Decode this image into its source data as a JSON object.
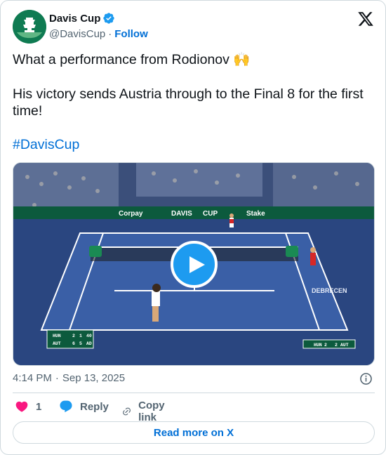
{
  "author": {
    "name": "Davis Cup",
    "handle": "@DavisCup",
    "separator": "·",
    "follow_label": "Follow"
  },
  "tweet": {
    "line1": "What a performance from Rodionov 🙌",
    "line2": "His victory sends Austria through to the Final 8 for the first time!",
    "hashtag": "#DavisCup"
  },
  "media": {
    "boards": [
      "Corpay",
      "DAVIS",
      "CUP",
      "Stake"
    ],
    "venue_text": "DEBRECEN",
    "score_left": {
      "rows": [
        {
          "team": "HUN",
          "set1": "2",
          "set2": "1",
          "points": "40"
        },
        {
          "team": "AUT",
          "set1": "6",
          "set2": "5",
          "points": "AD"
        }
      ]
    },
    "score_right": {
      "left_team": "HUN",
      "left_score": "2",
      "right_score": "2",
      "right_team": "AUT"
    }
  },
  "meta": {
    "time": "4:14 PM",
    "separator": "·",
    "date": "Sep 13, 2025"
  },
  "actions": {
    "like_count": "1",
    "reply_label": "Reply",
    "copy_label": "Copy link"
  },
  "read_more_label": "Read more on X",
  "colors": {
    "link": "#006fd6",
    "verified": "#1d9bf0",
    "like": "#f91880",
    "court": "#3a5fa6",
    "surround": "#2a4680"
  }
}
